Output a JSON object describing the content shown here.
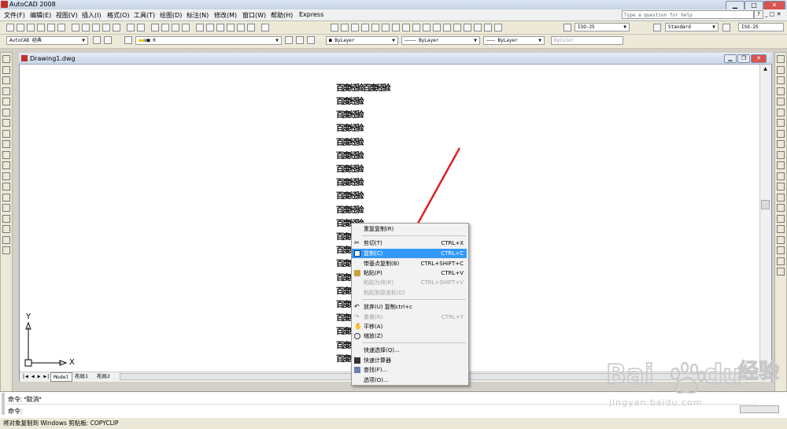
{
  "app": {
    "title": "AutoCAD 2008"
  },
  "menu": [
    "文件(F)",
    "编辑(E)",
    "视图(V)",
    "插入(I)",
    "格式(O)",
    "工具(T)",
    "绘图(D)",
    "标注(N)",
    "修改(M)",
    "窗口(W)",
    "帮助(H)",
    "Express"
  ],
  "help_search": {
    "placeholder": "Type a question for help"
  },
  "toolbar": {
    "dimstyle_combo": "ISO-25",
    "textstyle_combo": "Standard",
    "dimstyle_combo2": "ISO-25",
    "workspace_combo": "AutoCAD 经典",
    "layer_combo": "0",
    "color_combo": "ByLayer",
    "linetype_combo": "ByLayer",
    "lineweight_combo": "ByLayer",
    "plotstyle_combo": "ByColor"
  },
  "drawing": {
    "title": "Drawing1.dwg"
  },
  "layout_tabs": [
    "Model",
    "布局1",
    "布局2"
  ],
  "cad_text": {
    "top_line": "百度经验百度经验",
    "line": "百度经验"
  },
  "axis": {
    "x": "X",
    "y": "Y"
  },
  "context_menu": {
    "items": [
      {
        "label": "重复复制(R)",
        "shortcut": "",
        "state": "normal"
      },
      {
        "label": "剪切(T)",
        "shortcut": "CTRL+X",
        "state": "normal",
        "icon": "scissors-icon"
      },
      {
        "label": "复制(C)",
        "shortcut": "CTRL+C",
        "state": "highlighted",
        "icon": "copy-icon"
      },
      {
        "label": "带基点复制(B)",
        "shortcut": "CTRL+SHIFT+C",
        "state": "normal"
      },
      {
        "label": "粘贴(P)",
        "shortcut": "CTRL+V",
        "state": "normal",
        "icon": "paste-icon"
      },
      {
        "label": "粘贴为块(K)",
        "shortcut": "CTRL+SHIFT+V",
        "state": "disabled"
      },
      {
        "label": "粘贴到原坐标(D)",
        "shortcut": "",
        "state": "disabled"
      },
      {
        "label": "放弃(U) 复制ctrl+c",
        "shortcut": "",
        "state": "normal",
        "icon": "undo-icon"
      },
      {
        "label": "重做(R)",
        "shortcut": "CTRL+Y",
        "state": "disabled",
        "icon": "redo-icon"
      },
      {
        "label": "平移(A)",
        "shortcut": "",
        "state": "normal",
        "icon": "pan-icon"
      },
      {
        "label": "缩放(Z)",
        "shortcut": "",
        "state": "normal",
        "icon": "zoom-icon"
      },
      {
        "label": "快速选择(Q)...",
        "shortcut": "",
        "state": "normal"
      },
      {
        "label": "快速计算器",
        "shortcut": "",
        "state": "normal",
        "icon": "calculator-icon"
      },
      {
        "label": "查找(F)...",
        "shortcut": "",
        "state": "normal",
        "icon": "find-icon"
      },
      {
        "label": "选项(O)...",
        "shortcut": "",
        "state": "normal"
      }
    ]
  },
  "command": {
    "line1": "命令: *取消*",
    "line2": "命令:"
  },
  "status": {
    "text": "将对象复制到 Windows 剪贴板: COPYCLIP"
  },
  "watermark": {
    "brand": "Bai",
    "brand2": "du",
    "cn": "经验",
    "url": "jingyan.baidu.com"
  },
  "colors": {
    "highlight": "#3399ff",
    "arrow": "#e02020",
    "watermark": "#c8c8c8"
  }
}
